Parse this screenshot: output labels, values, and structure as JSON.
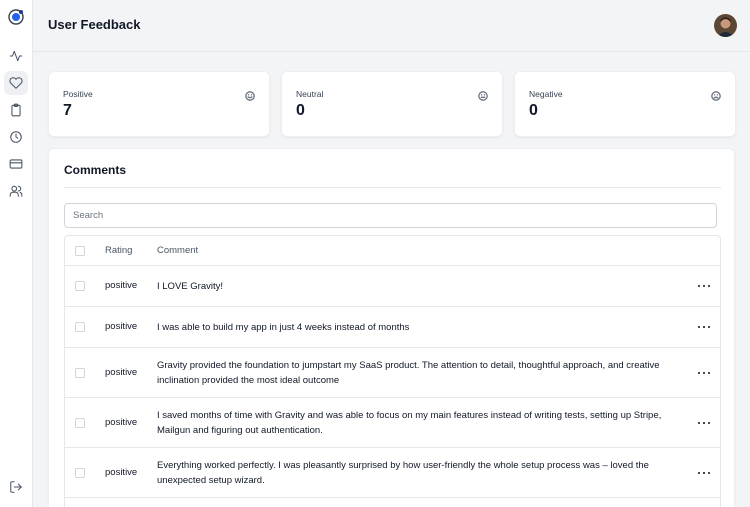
{
  "sidebar": {
    "logo": "gravity-logo-icon",
    "items": [
      {
        "name": "activity-icon"
      },
      {
        "name": "heart-icon",
        "active": true
      },
      {
        "name": "clipboard-icon"
      },
      {
        "name": "clock-icon"
      },
      {
        "name": "credit-card-icon"
      },
      {
        "name": "users-icon"
      }
    ],
    "logout": "sign-out-icon"
  },
  "header": {
    "title": "User Feedback"
  },
  "stats": [
    {
      "label": "Positive",
      "value": "7",
      "icon": "smile-icon"
    },
    {
      "label": "Neutral",
      "value": "0",
      "icon": "neutral-face-icon"
    },
    {
      "label": "Negative",
      "value": "0",
      "icon": "frown-icon"
    }
  ],
  "comments": {
    "title": "Comments",
    "search_placeholder": "Search",
    "columns": {
      "rating": "Rating",
      "comment": "Comment"
    },
    "rows": [
      {
        "rating": "positive",
        "comment": "I LOVE Gravity!"
      },
      {
        "rating": "positive",
        "comment": "I was able to build my app in just 4 weeks instead of months"
      },
      {
        "rating": "positive",
        "comment": "Gravity provided the foundation to jumpstart my SaaS product. The attention to detail, thoughtful approach, and creative inclination provided the most ideal outcome"
      },
      {
        "rating": "positive",
        "comment": "I saved months of time with Gravity and was able to focus on my main features instead of writing tests, setting up Stripe, Mailgun and figuring out authentication."
      },
      {
        "rating": "positive",
        "comment": "Everything worked perfectly. I was pleasantly surprised by how user-friendly the whole setup process was – loved the unexpected setup wizard."
      }
    ]
  },
  "colors": {
    "background": "#f3f4f6",
    "card": "#ffffff",
    "text": "#111827",
    "logo_blue": "#2563eb"
  }
}
